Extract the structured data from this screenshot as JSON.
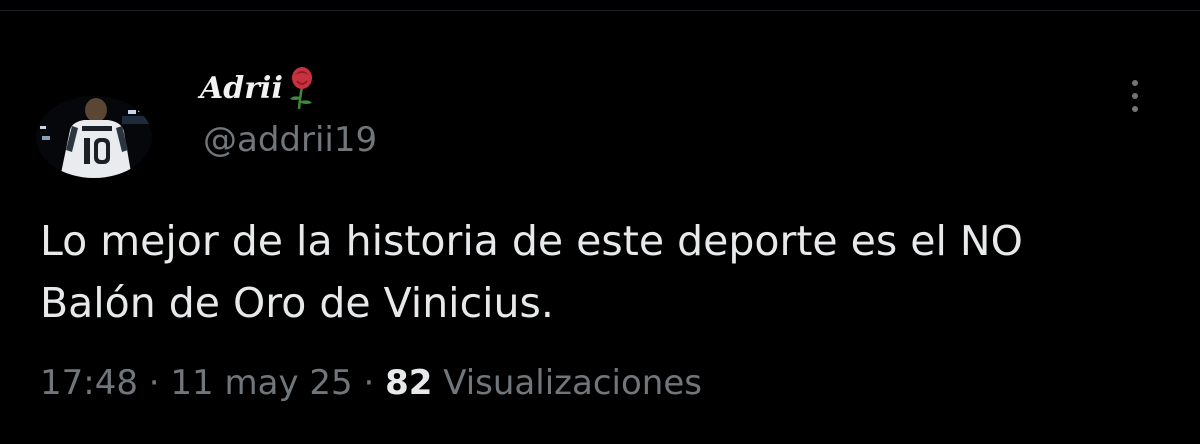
{
  "user": {
    "display_name": "Adrii",
    "handle": "@addrii19",
    "avatar_icon": "soccer-player-avatar",
    "name_emoji_icon": "rose-icon"
  },
  "tweet": {
    "text_line1": "Lo mejor de la historia de este deporte es el NO",
    "text_line2": "Balón de Oro de Vinicius."
  },
  "meta": {
    "time": "17:48",
    "separator1": " · ",
    "date": "11 may 25",
    "separator2": " · ",
    "views_count": "82",
    "views_label": " Visualizaciones"
  },
  "colors": {
    "background": "#000000",
    "primary_text": "#e7e9ea",
    "secondary_text": "#71767b",
    "rose": "#c8323f"
  },
  "actions": {
    "more_icon": "more-vertical-icon"
  }
}
